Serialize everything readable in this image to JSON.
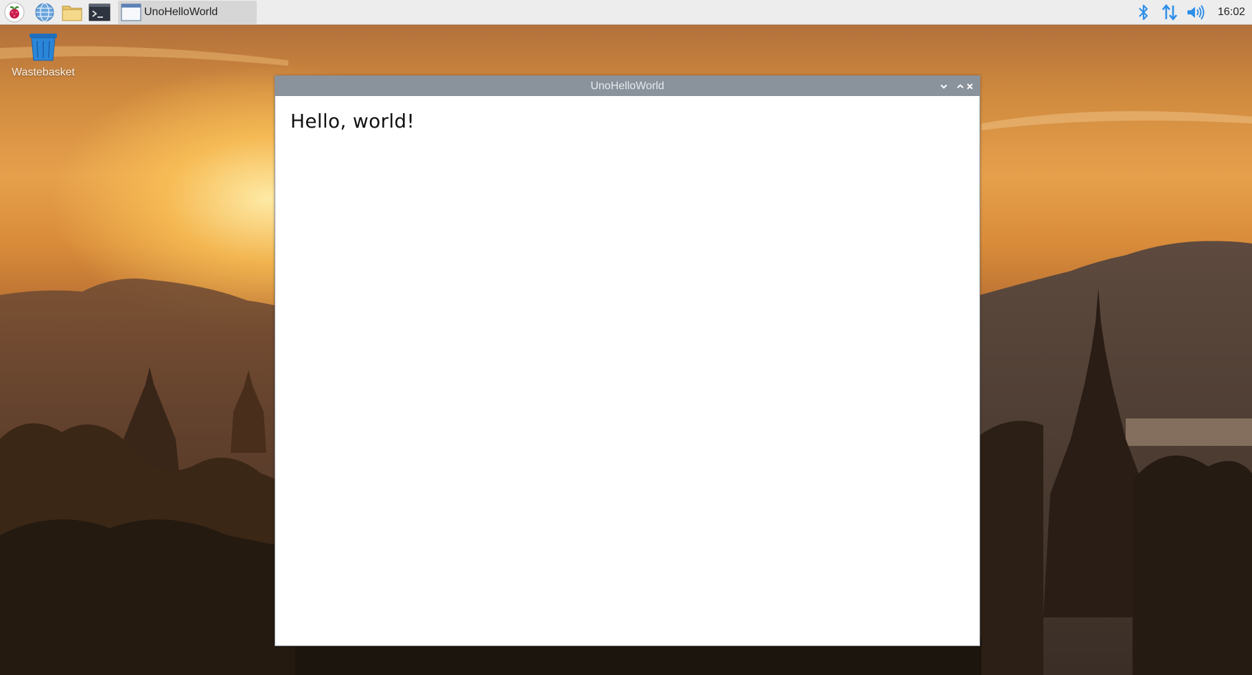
{
  "taskbar": {
    "launchers": [
      {
        "name": "raspberry-menu-icon"
      },
      {
        "name": "web-browser-icon"
      },
      {
        "name": "file-manager-icon"
      },
      {
        "name": "terminal-icon"
      }
    ],
    "task_label": "UnoHelloWorld",
    "tray": [
      "bluetooth-icon",
      "network-icon",
      "volume-icon"
    ],
    "clock": "16:02"
  },
  "desktop": {
    "icons": [
      {
        "label": "Wastebasket",
        "icon": "wastebasket-icon"
      }
    ]
  },
  "window": {
    "title": "UnoHelloWorld",
    "content_text": "Hello, world!"
  },
  "colors": {
    "panel_bg": "#ededed",
    "titlebar_bg": "#8a929b",
    "tray_accent": "#2f8fe8"
  }
}
